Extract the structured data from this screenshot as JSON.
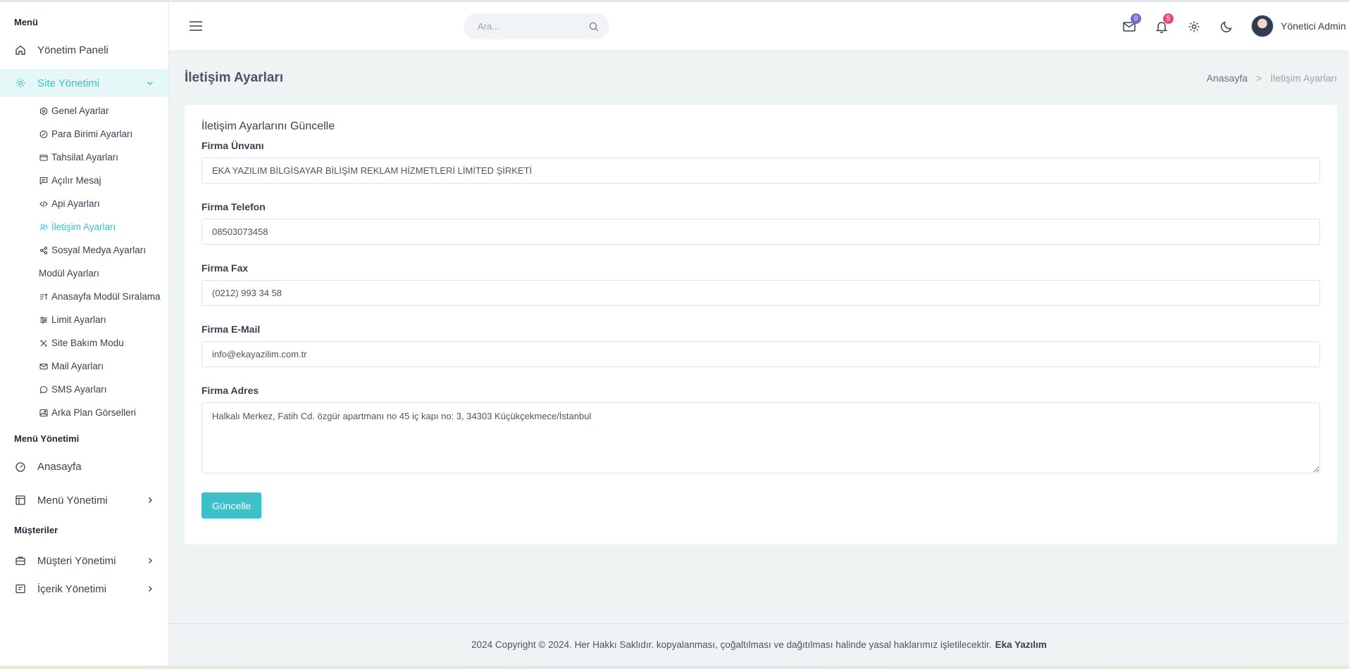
{
  "sidebar": {
    "sections": {
      "menu": "Menü",
      "menu_management": "Menü Yönetimi",
      "customers": "Müşteriler"
    },
    "dashboard": "Yönetim Paneli",
    "site_management": "Site Yönetimi",
    "sub_items": [
      {
        "label": "Genel Ayarlar",
        "icon": "hexagon-gear-icon"
      },
      {
        "label": "Para Birimi Ayarları",
        "icon": "currency-icon"
      },
      {
        "label": "Tahsilat Ayarları",
        "icon": "wallet-icon"
      },
      {
        "label": "Açılır Mesaj",
        "icon": "message-icon"
      },
      {
        "label": "Api Ayarları",
        "icon": "code-icon"
      },
      {
        "label": "İletişim Ayarları",
        "icon": "contact-icon"
      },
      {
        "label": "Sosyal Medya Ayarları",
        "icon": "share-icon"
      },
      {
        "label": "Modül Ayarları",
        "icon": ""
      },
      {
        "label": "Anasayfa Modül Sıralama",
        "icon": "sort-icon"
      },
      {
        "label": "Limit Ayarları",
        "icon": "sliders-icon"
      },
      {
        "label": "Site Bakım Modu",
        "icon": "tools-icon"
      },
      {
        "label": "Mail Ayarları",
        "icon": "mail-icon"
      },
      {
        "label": "SMS Ayarları",
        "icon": "chat-icon"
      },
      {
        "label": "Arka Plan Görselleri",
        "icon": "image-icon"
      }
    ],
    "homepage": "Anasayfa",
    "menu_management_item": "Menü Yönetimi",
    "customer_management": "Müşteri Yönetimi",
    "content_management": "İçerik Yönetimi"
  },
  "header": {
    "search_placeholder": "Ara...",
    "mail_badge": "0",
    "notification_badge": "5",
    "user_name": "Yönetici Admin",
    "colors": {
      "mail_badge": "#6f6ad1",
      "notification_badge": "#f0467a"
    }
  },
  "page": {
    "title": "İletişim Ayarları",
    "breadcrumb_home": "Anasayfa",
    "breadcrumb_current": "İletişim Ayarları"
  },
  "form": {
    "card_title": "İletişim Ayarlarını Güncelle",
    "company_name_label": "Firma Ünvanı",
    "company_name_value": "EKA YAZILIM BİLGİSAYAR BİLİŞİM REKLAM HİZMETLERİ LİMİTED ŞİRKETİ",
    "phone_label": "Firma Telefon",
    "phone_value": "08503073458",
    "fax_label": "Firma Fax",
    "fax_value": "(0212) 993 34 58",
    "email_label": "Firma E-Mail",
    "email_value": "info@ekayazilim.com.tr",
    "address_label": "Firma Adres",
    "address_value": "Halkalı Merkez, Fatih Cd. özgür apartmanı no 45 iç kapı no: 3, 34303 Küçükçekmece/İstanbul",
    "submit_label": "Güncelle"
  },
  "footer": {
    "text": "2024 Copyright © 2024. Her Hakkı Saklıdır. kopyalanması, çoğaltılması ve dağıtılması halinde yasal haklarımız işletilecektir.",
    "brand": "Eka Yazılım"
  },
  "theme": {
    "accent": "#3ec0c8",
    "background": "#eef3f4"
  }
}
